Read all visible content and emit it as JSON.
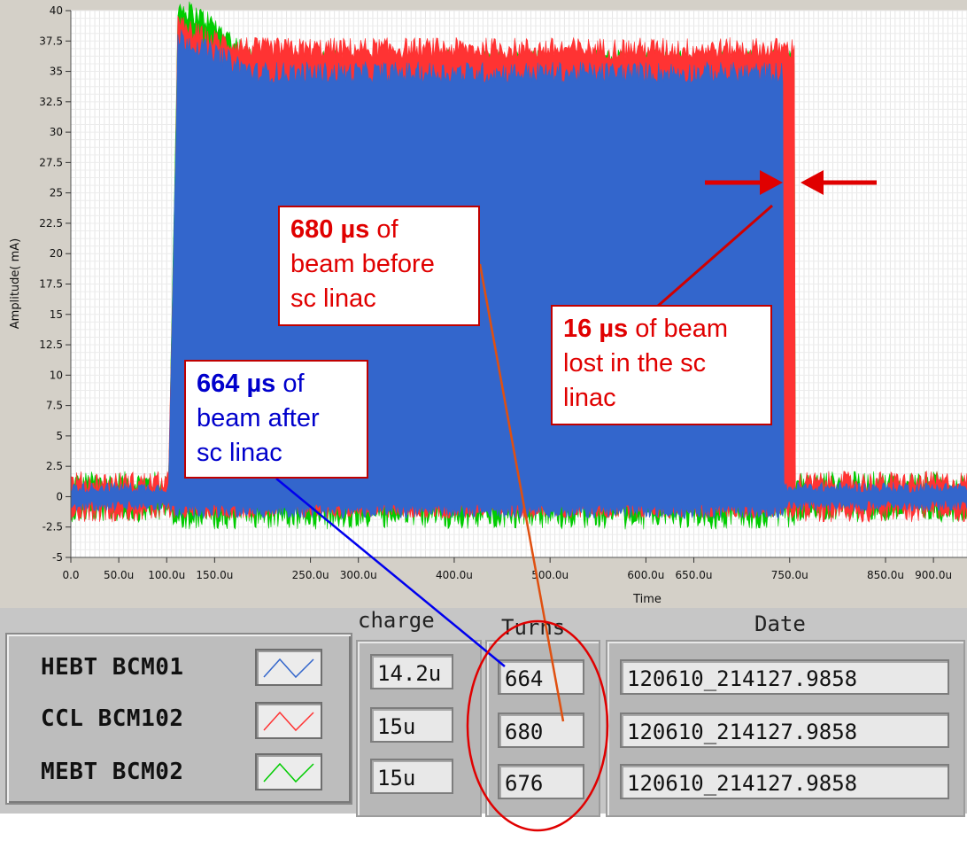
{
  "chart_data": {
    "type": "line",
    "xlabel": "Time",
    "ylabel": "Amplitude( mA)",
    "x_unit": "s",
    "xlim": [
      0,
      0.000935
    ],
    "ylim": [
      -5,
      40
    ],
    "x_ticks": [
      "0.0",
      "50.0u",
      "100.0u",
      "150.0u",
      "250.0u",
      "300.0u",
      "400.0u",
      "500.0u",
      "600.0u",
      "650.0u",
      "750.0u",
      "850.0u",
      "900.0u"
    ],
    "y_ticks": [
      "40",
      "37.5",
      "35",
      "32.5",
      "30",
      "27.5",
      "25",
      "22.5",
      "20",
      "17.5",
      "15",
      "12.5",
      "10",
      "7.5",
      "5",
      "2.5",
      "0",
      "-2.5",
      "-5"
    ],
    "grid": true,
    "series": [
      {
        "name": "HEBT BCM01",
        "color": "#3366cc",
        "pulse_start_s": 0.000103,
        "pulse_end_s": 0.000744,
        "peak_mA": 37,
        "flat_top_mA": 34,
        "baseline_mA": 0
      },
      {
        "name": "CCL BCM102",
        "color": "#ff3333",
        "pulse_start_s": 0.000103,
        "pulse_end_s": 0.000755,
        "peak_mA": 38,
        "flat_top_mA": 36,
        "baseline_mA": 0
      },
      {
        "name": "MEBT BCM02",
        "color": "#00cc00",
        "pulse_start_s": 0.000103,
        "pulse_end_s": 0.000755,
        "peak_mA": 39.5,
        "flat_top_mA": 35,
        "baseline_mA": 0
      }
    ]
  },
  "annotations": {
    "before": {
      "value": "680 µs",
      "text1": " of",
      "text2": "beam  before",
      "text3": "sc linac"
    },
    "after": {
      "value": "664 µs",
      "text1": " of",
      "text2": "beam  after",
      "text3": "sc linac"
    },
    "lost": {
      "value": "16 µs",
      "text1": " of beam",
      "text2": "lost in the sc",
      "text3": "linac"
    }
  },
  "table": {
    "headers": {
      "charge": "charge",
      "turns": "Turns",
      "date": "Date"
    },
    "rows": [
      {
        "name": "HEBT BCM01",
        "color": "#3366cc",
        "charge": "14.2u",
        "turns": "664",
        "date": "120610_214127.9858"
      },
      {
        "name": "CCL BCM102",
        "color": "#ff3333",
        "charge": "15u",
        "turns": "680",
        "date": "120610_214127.9858"
      },
      {
        "name": "MEBT BCM02",
        "color": "#00cc00",
        "charge": "15u",
        "turns": "676",
        "date": "120610_214127.9858"
      }
    ]
  },
  "colors": {
    "arrow": "#e00000",
    "ellipse": "#e00000",
    "blue_line": "#0000ee",
    "red_line": "#e05010"
  }
}
